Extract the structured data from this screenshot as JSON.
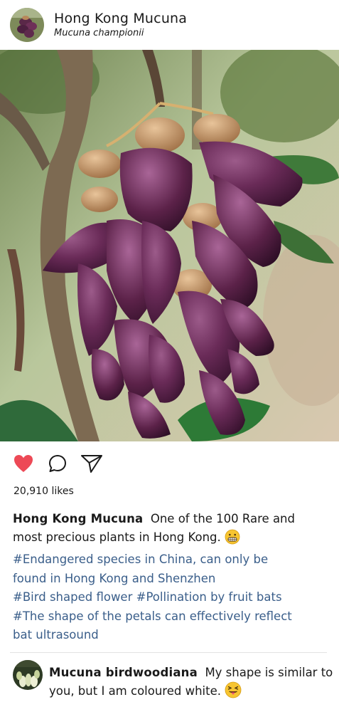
{
  "header": {
    "account_name": "Hong Kong Mucuna",
    "account_subtitle": "Mucuna championii",
    "avatar_icon": "mucuna-flower-avatar"
  },
  "post": {
    "image_subject": "Hong Kong Mucuna flower cluster",
    "actions": {
      "like_icon": "heart-icon",
      "like_color": "#ed4956",
      "comment_icon": "comment-bubble-icon",
      "share_icon": "paper-plane-icon"
    },
    "likes_count": "20,910",
    "likes_suffix": "likes",
    "caption": {
      "username": "Hong Kong Mucuna",
      "text": "One of the 100 Rare and most precious plants in Hong Kong.",
      "emoji_icon": "grimacing-face-emoji"
    },
    "hashtags": [
      "#Endangered species in China, can only be",
      "found in Hong Kong and Shenzhen",
      "#Bird shaped flower #Pollination by fruit bats",
      "#The shape of the petals can effectively reflect",
      "bat ultrasound"
    ],
    "hashtag_color": "#3a5e8a"
  },
  "comment": {
    "username": "Mucuna birdwoodiana",
    "text": "My shape is similar to you, but I am coloured white.",
    "emoji_icon": "tongue-squint-face-emoji",
    "avatar_icon": "white-mucuna-avatar"
  }
}
